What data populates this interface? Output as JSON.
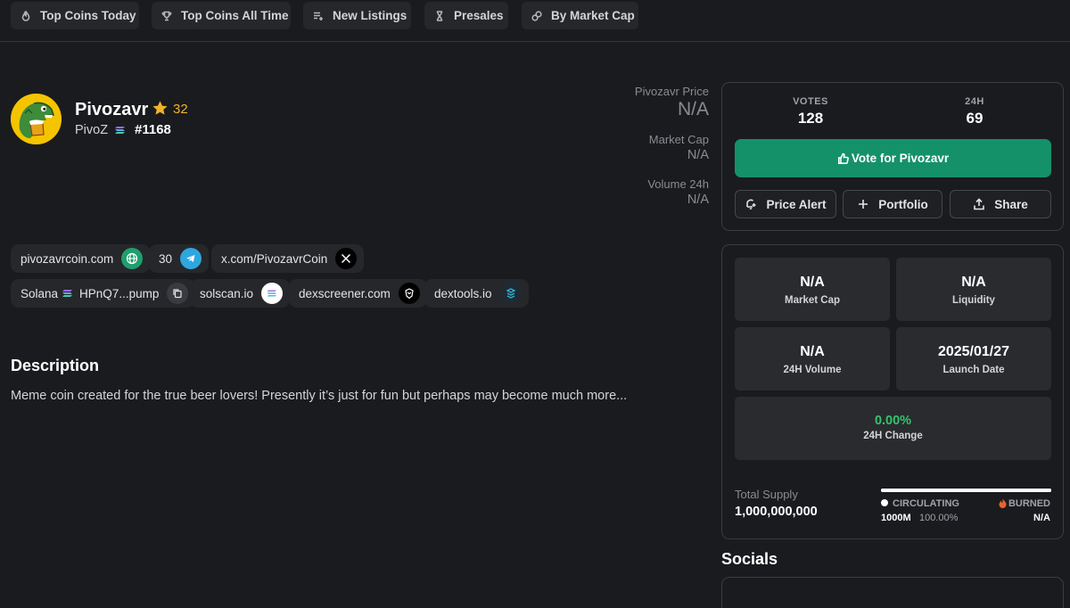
{
  "nav": {
    "items": [
      {
        "label": "Top Coins Today",
        "icon": "flame-icon"
      },
      {
        "label": "Top Coins All Time",
        "icon": "trophy-icon"
      },
      {
        "label": "New Listings",
        "icon": "list-plus-icon"
      },
      {
        "label": "Presales",
        "icon": "hourglass-icon"
      },
      {
        "label": "By Market Cap",
        "icon": "coins-icon"
      }
    ]
  },
  "coin": {
    "name": "Pivozavr",
    "stars": "32",
    "ticker": "PivoZ",
    "rank": "#1168",
    "logo_bg": "#f5c400"
  },
  "price_stats": {
    "price_label": "Pivozavr Price",
    "price_value": "N/A",
    "market_cap_label": "Market Cap",
    "market_cap_value": "N/A",
    "volume_label": "Volume 24h",
    "volume_value": "N/A"
  },
  "links": {
    "website": "pivozavrcoin.com",
    "telegram_count": "30",
    "twitter": "x.com/PivozavrCoin",
    "chain": "Solana",
    "contract": "HPnQ7...pump",
    "solscan": "solscan.io",
    "dexscreener": "dexscreener.com",
    "dextools": "dextools.io"
  },
  "description": {
    "title": "Description",
    "text": "Meme coin created for the true beer lovers! Presently it’s just for fun but perhaps may become much more..."
  },
  "votes": {
    "votes_label": "VOTES",
    "votes_value": "128",
    "h24_label": "24H",
    "h24_value": "69",
    "vote_button": "Vote for Pivozavr",
    "price_alert": "Price Alert",
    "portfolio": "Portfolio",
    "share": "Share",
    "accent": "#15916a"
  },
  "market": {
    "market_cap_value": "N/A",
    "market_cap_label": "Market Cap",
    "liquidity_value": "N/A",
    "liquidity_label": "Liquidity",
    "volume_value": "N/A",
    "volume_label": "24H Volume",
    "launch_value": "2025/01/27",
    "launch_label": "Launch Date",
    "change_value": "0.00%",
    "change_label": "24H Change",
    "change_color": "#33c46b"
  },
  "supply": {
    "total_label": "Total Supply",
    "total_value": "1,000,000,000",
    "circulating_label": "CIRCULATING",
    "circulating_amount": "1000M",
    "circulating_pct": "100.00%",
    "circulating_fraction": 1.0,
    "burned_label": "BURNED",
    "burned_value": "N/A"
  },
  "socials": {
    "title": "Socials"
  }
}
